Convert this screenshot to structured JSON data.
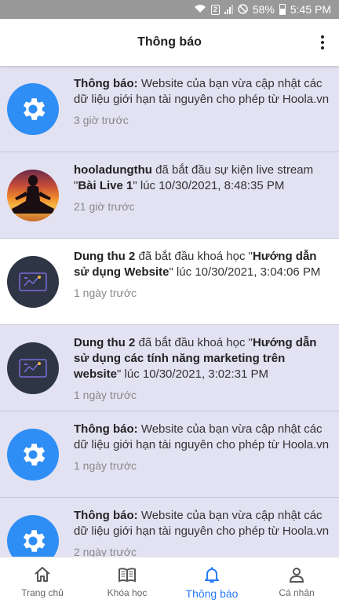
{
  "status_bar": {
    "sim": "2",
    "battery": "58%",
    "time": "5:45 PM"
  },
  "header": {
    "title": "Thông báo",
    "menu_icon": "kebab-menu-icon"
  },
  "notifications": [
    {
      "type": "system",
      "actor": "Thông báo:",
      "text": " Website của bạn vừa cập nhật các dữ liệu giới hạn tài nguyên cho phép từ Hoola.vn",
      "time": "3 giờ trước",
      "read": false
    },
    {
      "type": "live",
      "actor": "hooladungthu",
      "text_pre": " đã bắt đầu sự kiện live stream \"",
      "target": "Bài Live 1",
      "text_post": "\" lúc 10/30/2021, 8:48:35 PM",
      "time": "21 giờ trước",
      "read": false
    },
    {
      "type": "course",
      "actor": "Dung thu 2",
      "text_pre": " đã bắt đầu khoá học \"",
      "target": "Hướng dẫn sử dụng Website",
      "text_post": "\" lúc 10/30/2021, 3:04:06 PM",
      "time": "1 ngày trước",
      "read": true
    },
    {
      "type": "course",
      "actor": "Dung thu 2",
      "text_pre": " đã bắt đầu khoá học \"",
      "target": "Hướng dẫn sử dụng các tính năng marketing trên website",
      "text_post": "\" lúc 10/30/2021, 3:02:31 PM",
      "time": "1 ngày trước",
      "read": false
    },
    {
      "type": "system",
      "actor": "Thông báo:",
      "text": " Website của bạn vừa cập nhật các dữ liệu giới hạn tài nguyên cho phép từ Hoola.vn",
      "time": "1 ngày trước",
      "read": false
    },
    {
      "type": "system",
      "actor": "Thông báo:",
      "text": " Website của bạn vừa cập nhật các dữ liệu giới hạn tài nguyên cho phép từ Hoola.vn",
      "time": "2 ngày trước",
      "read": false
    }
  ],
  "bottom_nav": [
    {
      "label": "Trang chủ",
      "icon": "home-icon",
      "active": false
    },
    {
      "label": "Khóa học",
      "icon": "book-icon",
      "active": false
    },
    {
      "label": "Thông báo",
      "icon": "bell-icon",
      "active": true
    },
    {
      "label": "Cá nhân",
      "icon": "person-icon",
      "active": false
    }
  ],
  "colors": {
    "accent": "#2b7cf7",
    "unread_bg": "#e3e2f3",
    "gear_avatar": "#2f8ef5",
    "course_avatar": "#2e3544"
  }
}
